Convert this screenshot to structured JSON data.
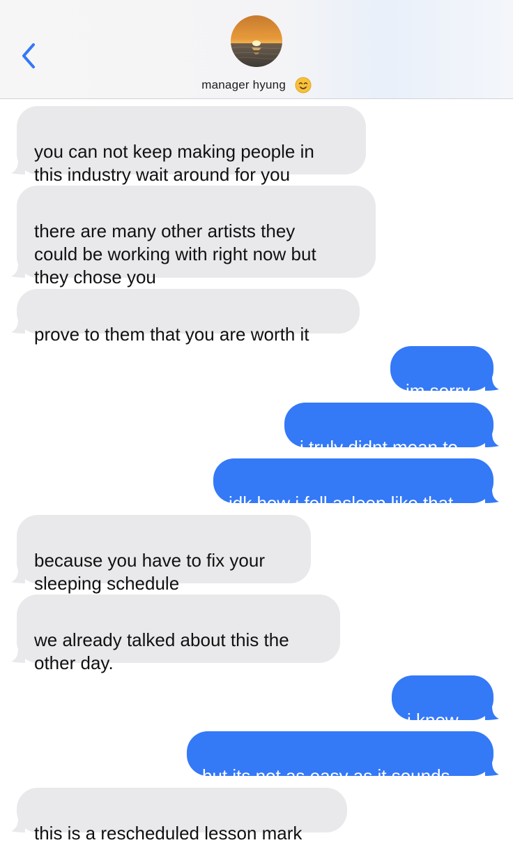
{
  "header": {
    "back_icon": "chevron-left-icon",
    "contact_name": "manager hyung",
    "contact_emoji": "smiling-face-emoji",
    "avatar": "sunset-over-sea-photo"
  },
  "colors": {
    "received_bubble": "#e9e9eb",
    "sent_bubble": "#3479f6",
    "accent": "#3478f6"
  },
  "messages": [
    {
      "direction": "received",
      "text": "you can not keep making people in\nthis industry wait around for you"
    },
    {
      "direction": "received",
      "text": "there are many other artists they\ncould be working with right now but\nthey chose you"
    },
    {
      "direction": "received",
      "text": "prove to them that you are worth it"
    },
    {
      "direction": "sent",
      "text": "im sorry"
    },
    {
      "direction": "sent",
      "text": "i truly didnt mean to"
    },
    {
      "direction": "sent",
      "text": "idk how i fell asleep like that"
    },
    {
      "direction": "received",
      "text": "because you have to fix your\nsleeping schedule"
    },
    {
      "direction": "received",
      "text": "we already talked about this the\nother day."
    },
    {
      "direction": "sent",
      "text": "i know..."
    },
    {
      "direction": "sent",
      "text": "but its not as easy as it sounds"
    },
    {
      "direction": "received",
      "text": "this is a rescheduled lesson mark"
    }
  ]
}
